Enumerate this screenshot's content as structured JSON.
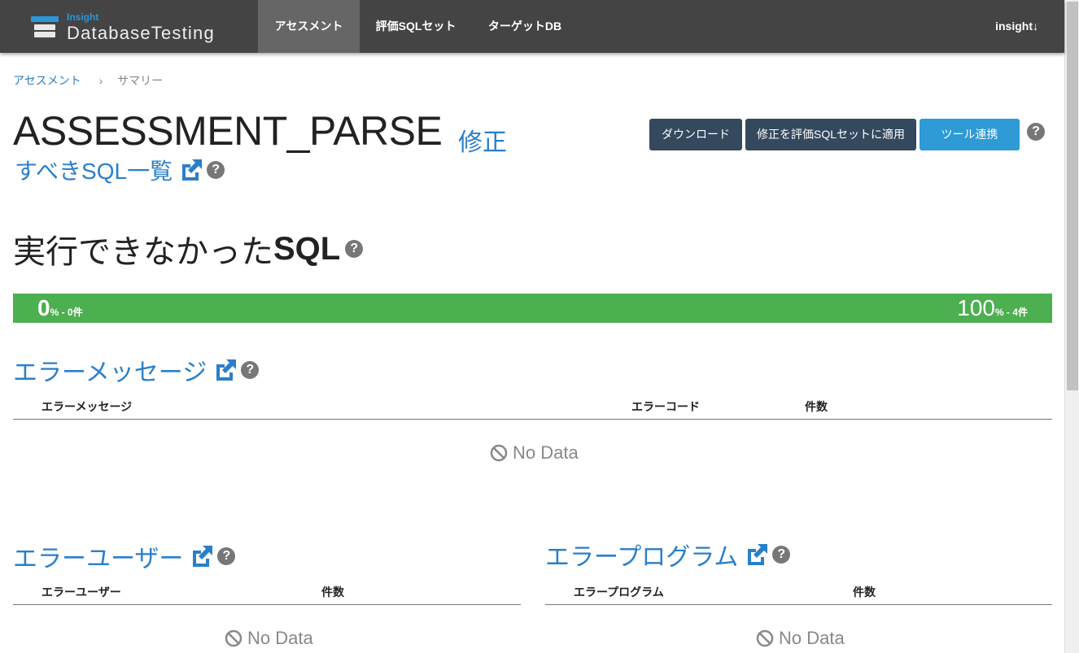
{
  "navbar": {
    "brand_small": "Insight",
    "brand_name": "DatabaseTesting",
    "items": [
      "アセスメント",
      "評価SQLセット",
      "ターゲットDB"
    ],
    "user": "insight"
  },
  "breadcrumb": {
    "link": "アセスメント",
    "separator": "›",
    "current": "サマリー"
  },
  "title": "ASSESSMENT_PARSE",
  "title_link": "修正",
  "sub_link": "すべきSQL一覧",
  "buttons": {
    "download": "ダウンロード",
    "apply": "修正を評価SQLセットに適用",
    "tool": "ツール連携"
  },
  "failed_section": {
    "title_prefix": "実行できなかった",
    "title_bold": "SQL",
    "progress": {
      "fraction_value": 0,
      "left_pct": "0",
      "left_suffix": "% - 0件",
      "right_pct": "100",
      "right_suffix": "% - 4件"
    }
  },
  "error_message": {
    "title": "エラーメッセージ",
    "columns": [
      "エラーメッセージ",
      "エラーコード",
      "件数"
    ],
    "empty": "No Data"
  },
  "error_user": {
    "title": "エラーユーザー",
    "columns": [
      "エラーユーザー",
      "件数"
    ],
    "empty": "No Data"
  },
  "error_program": {
    "title": "エラープログラム",
    "columns": [
      "エラープログラム",
      "件数"
    ],
    "empty": "No Data"
  },
  "colors": {
    "navbar": "#444444",
    "active_tab": "#666666",
    "link": "#2a7fc9",
    "progress_green": "#4caf50",
    "btn_dark": "#34495e",
    "btn_blue": "#2e9ad6"
  }
}
